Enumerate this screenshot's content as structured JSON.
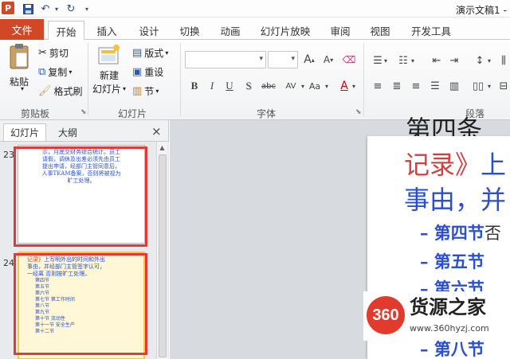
{
  "titlebar": {
    "app_logo": "P",
    "title": "演示文稿1 -",
    "quick_access": [
      "save-icon",
      "undo-icon",
      "redo-icon",
      "customize-icon"
    ]
  },
  "tabs": {
    "file": "文件",
    "items": [
      "开始",
      "插入",
      "设计",
      "切换",
      "动画",
      "幻灯片放映",
      "审阅",
      "视图",
      "开发工具"
    ],
    "active": "开始"
  },
  "ribbon": {
    "clipboard": {
      "paste": "粘贴",
      "cut": "剪切",
      "copy": "复制",
      "format_painter": "格式刷",
      "label": "剪贴板"
    },
    "slides": {
      "new_slide": "新建",
      "new_slide_2": "幻灯片",
      "layout": "版式",
      "reset": "重设",
      "section": "节",
      "label": "幻灯片"
    },
    "font": {
      "label": "字体",
      "bold": "B",
      "italic": "I",
      "underline": "U",
      "shadow": "S",
      "strike": "abc",
      "spacing": "AV",
      "case": "Aa",
      "grow": "A",
      "shrink": "A"
    },
    "paragraph": {
      "label": "段落"
    }
  },
  "left_pane": {
    "tabs": [
      "幻灯片",
      "大纲"
    ],
    "active_tab": "幻灯片",
    "close": "×",
    "slides": [
      {
        "number": "23",
        "lines": [
          "示，月底交财务综合统计。员工",
          "请假，调休及出差必须先由员工",
          "提出申请，经部门主管同意后，",
          "人事TEAM备案，否则将被视为",
          "旷工处理。"
        ]
      },
      {
        "number": "24",
        "lines_red": "记录》",
        "line1": "上写明外出的时间和外出",
        "line2": "事由，并经部门主管签字认可，",
        "line3": "一经离 否则按旷工处理。",
        "items": [
          "第四节",
          "第五节",
          "第六节",
          "第七节 第工作时间",
          "第八节",
          "第九节",
          "第十节 流动性",
          "第十一节 安全生产",
          "第十二节"
        ]
      }
    ]
  },
  "slide_view": {
    "top_partial": "第四条",
    "line_red": "记录》",
    "line_red_tail": "上",
    "line_blue": "事由，并",
    "items": [
      "– 第四节",
      "– 第五节",
      "– 第六节",
      "– 第八节"
    ],
    "item_overflow": "否"
  },
  "watermark": {
    "badge": "360",
    "title": "货源之家",
    "url": "www.360hyzj.com"
  }
}
